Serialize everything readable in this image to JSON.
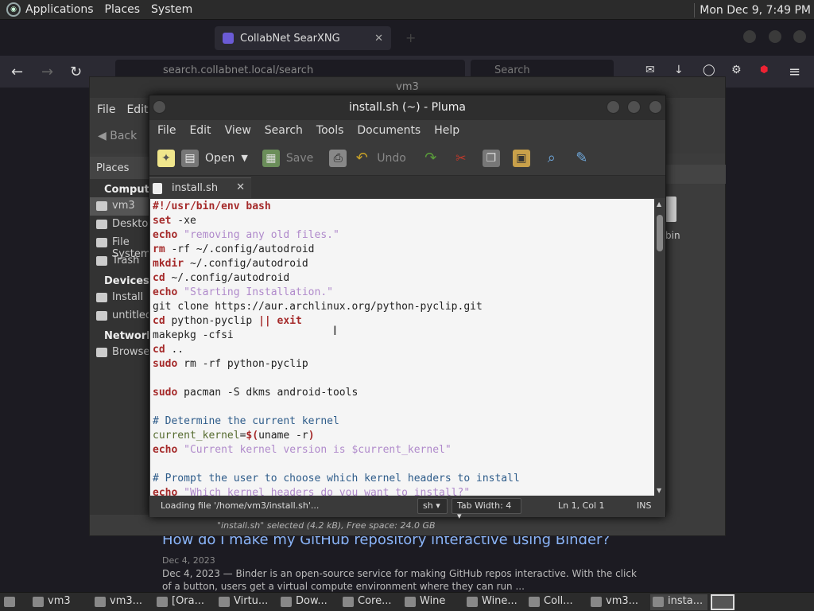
{
  "top_panel": {
    "menus": [
      "Applications",
      "Places",
      "System"
    ],
    "clock": "Mon Dec 9, 7:49 PM"
  },
  "firefox": {
    "tab_active": "CollabNet SearXNG",
    "url": "search.collabnet.local/search",
    "search_placeholder": "Search",
    "result": {
      "title": "How do I make my GitHub repository interactive using Binder?",
      "date": "Dec 4, 2023",
      "desc": "Dec 4, 2023 — Binder is an open-source service for making GitHub repos interactive. With the click of a button, users get a virtual compute environment where they can run ..."
    }
  },
  "caja": {
    "title": "vm3",
    "menu": [
      "File",
      "Edit"
    ],
    "back_label": "Back",
    "places_label": "Places",
    "sections": [
      {
        "name": "Computer",
        "items": [
          "vm3",
          "Desktop",
          "File System",
          "Trash"
        ]
      },
      {
        "name": "Devices",
        "items": [
          "Install",
          "untitled"
        ]
      },
      {
        "name": "Network",
        "items": [
          "Browse"
        ]
      }
    ],
    "file_label": "bin",
    "status": "\"install.sh\" selected (4.2 kB), Free space: 24.0 GB"
  },
  "pluma": {
    "title": "install.sh (~) - Pluma",
    "menu": [
      "File",
      "Edit",
      "View",
      "Search",
      "Tools",
      "Documents",
      "Help"
    ],
    "toolbar": {
      "open": "Open",
      "save": "Save",
      "undo": "Undo"
    },
    "tab_label": "install.sh",
    "status": {
      "loading": "Loading file '/home/vm3/install.sh'...",
      "language": "sh",
      "tab_width": "Tab Width:  4",
      "position": "Ln 1, Col 1",
      "mode": "INS"
    },
    "code_lines": [
      "#!/usr/bin/env bash",
      "set -xe",
      "echo \"removing any old files.\"",
      "rm -rf ~/.config/autodroid",
      "mkdir ~/.config/autodroid",
      "cd ~/.config/autodroid",
      "echo \"Starting Installation.\"",
      "git clone https://aur.archlinux.org/python-pyclip.git",
      "cd python-pyclip || exit",
      "makepkg -cfsi",
      "cd ..",
      "sudo rm -rf python-pyclip",
      "",
      "sudo pacman -S dkms android-tools",
      "",
      "# Determine the current kernel",
      "current_kernel=$(uname -r)",
      "echo \"Current kernel version is $current_kernel\"",
      "",
      "# Prompt the user to choose which kernel headers to install",
      "echo \"Which kernel headers do you want to install?\""
    ]
  },
  "taskbar": {
    "items": [
      "vm3",
      "vm3...",
      "[Ora...",
      "Virtu...",
      "Dow...",
      "Core...",
      "Wine",
      "Wine...",
      "Coll...",
      "vm3...",
      "insta..."
    ]
  }
}
